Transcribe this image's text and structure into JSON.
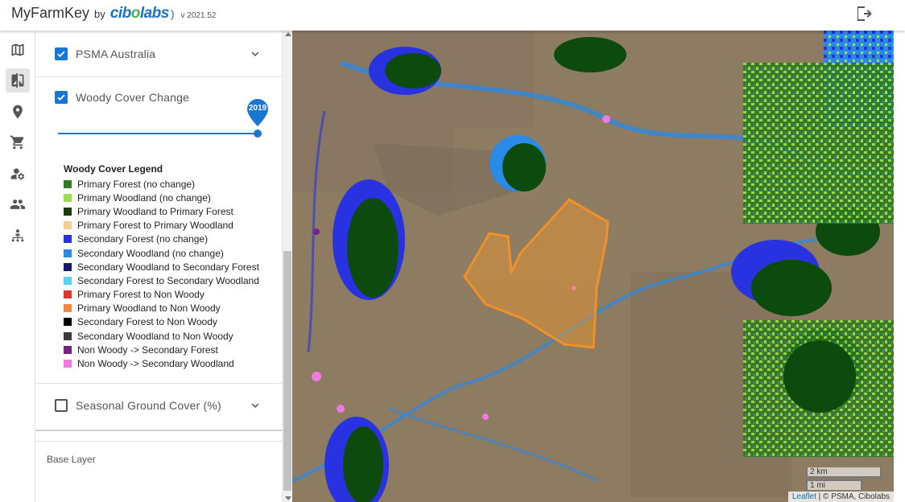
{
  "header": {
    "app_name": "MyFarmKey",
    "by": "by",
    "logo_text_a": "cib",
    "logo_text_b": "o",
    "logo_text_c": "labs",
    "logo_paren": ")",
    "version": "v 2021.52"
  },
  "nav": {
    "items": [
      {
        "icon": "map-icon"
      },
      {
        "icon": "layers-compare-icon",
        "active": true
      },
      {
        "icon": "location-pin-icon"
      },
      {
        "icon": "shopping-cart-icon"
      },
      {
        "icon": "user-settings-icon"
      },
      {
        "icon": "people-icon"
      },
      {
        "icon": "org-chart-icon"
      }
    ]
  },
  "layers": {
    "psma": {
      "label": "PSMA Australia",
      "checked": true
    },
    "woody": {
      "label": "Woody Cover Change",
      "checked": true,
      "slider_value": "2019"
    },
    "seasonal": {
      "label": "Seasonal Ground Cover (%)",
      "checked": false
    }
  },
  "legend": {
    "title": "Woody Cover Legend",
    "items": [
      {
        "label": "Primary Forest (no change)",
        "color": "#2e7d1e"
      },
      {
        "label": "Primary Woodland (no change)",
        "color": "#9be04a"
      },
      {
        "label": "Primary Woodland to Primary Forest",
        "color": "#173d0e"
      },
      {
        "label": "Primary Forest to Primary Woodland",
        "color": "#f5cf8c"
      },
      {
        "label": "Secondary Forest (no change)",
        "color": "#2832e0"
      },
      {
        "label": "Secondary Woodland (no change)",
        "color": "#2a8ae8"
      },
      {
        "label": "Secondary Woodland to Secondary Forest",
        "color": "#14186e"
      },
      {
        "label": "Secondary Forest to Secondary Woodland",
        "color": "#54d6f0"
      },
      {
        "label": "Primary Forest to Non Woody",
        "color": "#e0352a"
      },
      {
        "label": "Primary Woodland to Non Woody",
        "color": "#f0873a"
      },
      {
        "label": "Secondary Forest to Non Woody",
        "color": "#000000"
      },
      {
        "label": "Secondary Woodland to Non Woody",
        "color": "#3a3a3a"
      },
      {
        "label": "Non Woody -> Secondary Forest",
        "color": "#7a1f86"
      },
      {
        "label": "Non Woody -> Secondary Woodland",
        "color": "#f07ae0"
      }
    ]
  },
  "base_layer": {
    "label": "Base Layer"
  },
  "map": {
    "scale_km": "2 km",
    "scale_mi": "1 mi",
    "attribution_link": "Leaflet",
    "attribution_text": " | © PSMA, Cibolabs"
  }
}
